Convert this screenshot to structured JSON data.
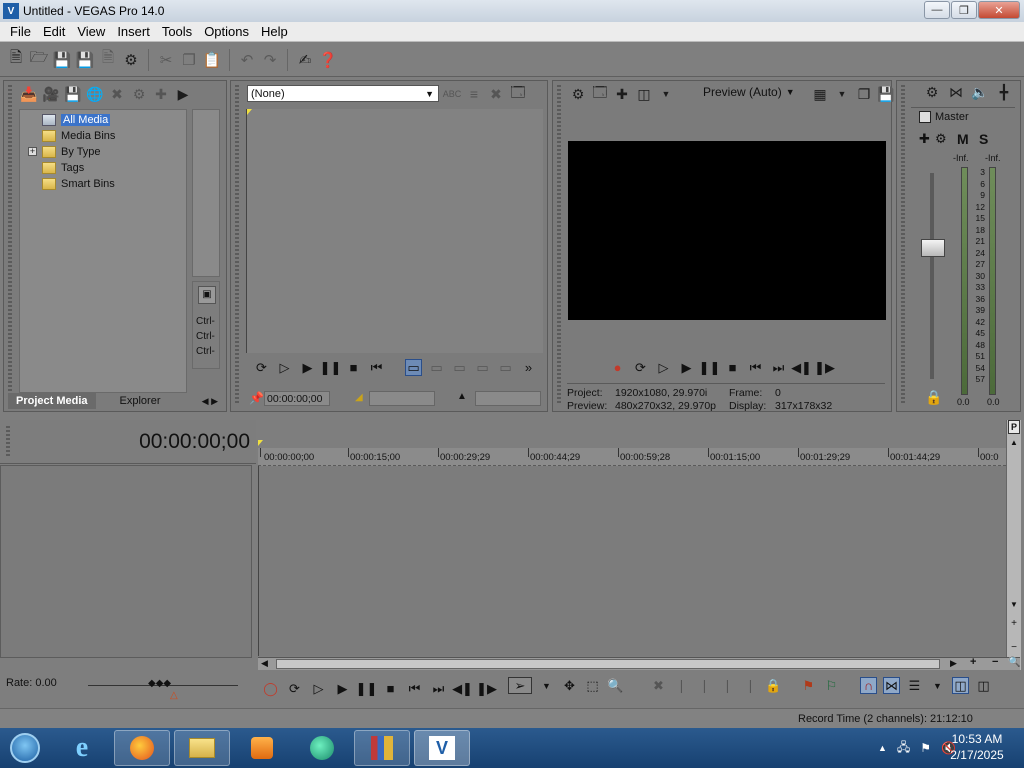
{
  "window": {
    "title": "Untitled - VEGAS Pro 14.0",
    "app_glyph": "V"
  },
  "menu": [
    "File",
    "Edit",
    "View",
    "Insert",
    "Tools",
    "Options",
    "Help"
  ],
  "project_media": {
    "tree": [
      {
        "label": "All Media",
        "selected": true
      },
      {
        "label": "Media Bins",
        "selected": false
      },
      {
        "label": "By Type",
        "selected": false,
        "expandable": true
      },
      {
        "label": "Tags",
        "selected": false
      },
      {
        "label": "Smart Bins",
        "selected": false
      }
    ],
    "ctrl_labels": [
      "Ctrl-",
      "Ctrl-",
      "Ctrl-"
    ],
    "tabs": {
      "active": "Project Media",
      "inactive": "Explorer"
    }
  },
  "trimmer": {
    "selected_media": "(None)",
    "timecode": "00:00:00;00"
  },
  "preview": {
    "mode_label": "Preview (Auto)",
    "project_label": "Project:",
    "project_value": "1920x1080, 29.970i",
    "preview_label": "Preview:",
    "preview_value": "480x270x32, 29.970p",
    "frame_label": "Frame:",
    "frame_value": "0",
    "display_label": "Display:",
    "display_value": "317x178x32"
  },
  "mixer": {
    "master_label": "Master",
    "mute": "M",
    "solo": "S",
    "inf_left": "-Inf.",
    "inf_right": "-Inf.",
    "scale": [
      "3",
      "6",
      "9",
      "12",
      "15",
      "18",
      "21",
      "24",
      "27",
      "30",
      "33",
      "36",
      "39",
      "42",
      "45",
      "48",
      "51",
      "54",
      "57"
    ],
    "value_left": "0.0",
    "value_right": "0.0"
  },
  "timeline": {
    "cursor_timecode": "00:00:00;00",
    "ruler": [
      "00:00:00;00",
      "00:00:15;00",
      "00:00:29;29",
      "00:00:44;29",
      "00:00:59;28",
      "00:01:15;00",
      "00:01:29;29",
      "00:01:44;29",
      "00:0"
    ],
    "rate": "Rate: 0.00"
  },
  "status": {
    "record_time": "Record Time (2 channels): 21:12:10"
  },
  "taskbar": {
    "time": "10:53 AM",
    "date": "2/17/2025"
  }
}
